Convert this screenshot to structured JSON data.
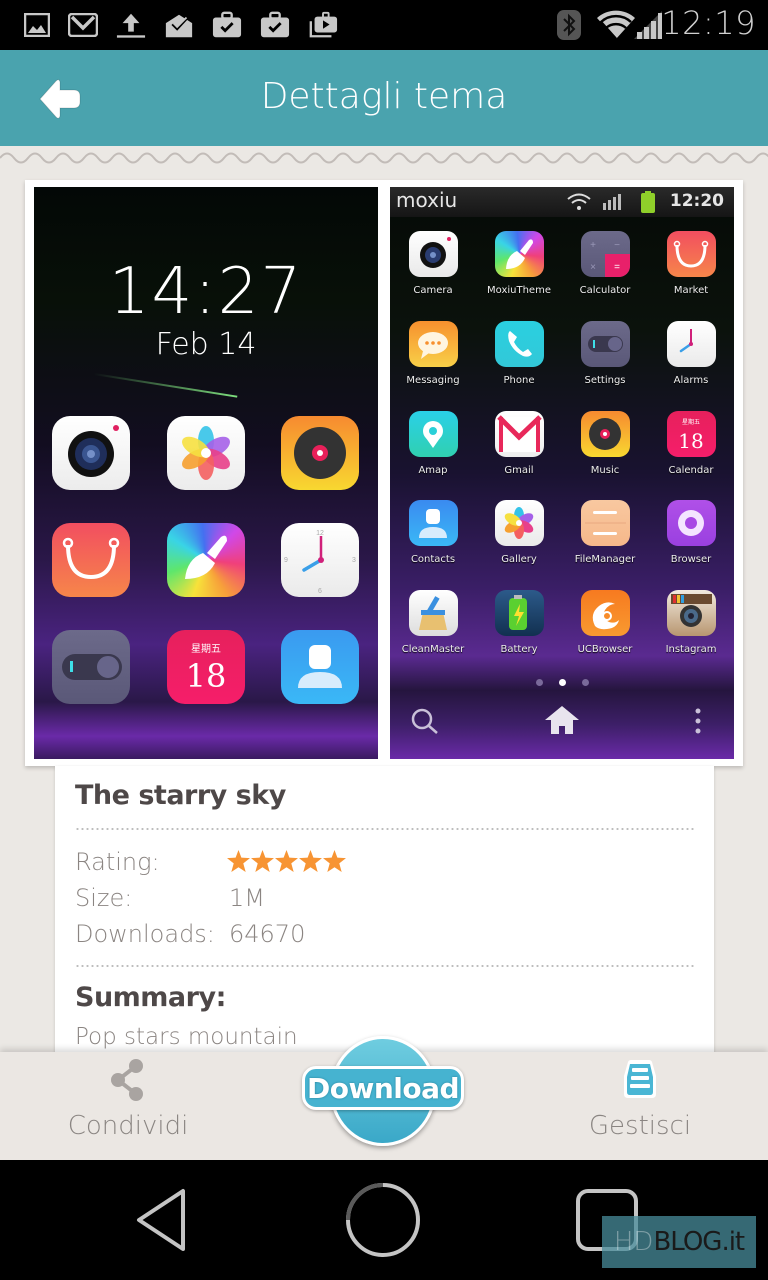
{
  "status_bar": {
    "notification_icons": [
      "gallery-icon",
      "gmail-icon",
      "upload-icon",
      "email-check-icon",
      "briefcase-check-icon",
      "briefcase-check-icon",
      "media-play-icon"
    ],
    "system_icons": [
      "bluetooth-icon",
      "wifi-icon",
      "signal-icon"
    ],
    "time": "12:19"
  },
  "app_bar": {
    "title": "Dettagli tema",
    "back_icon": "back-arrow-icon",
    "color": "#4aa3ae"
  },
  "preview_left": {
    "lock_time": "14:27",
    "lock_date": "Feb 14",
    "calendar_weekday": "星期五",
    "calendar_day": "18",
    "icons": [
      "camera",
      "gallery",
      "music",
      "market",
      "moxiu-theme",
      "clock",
      "settings",
      "calendar",
      "contacts"
    ]
  },
  "preview_right": {
    "brand": "moxiu",
    "time": "12:20",
    "calendar_weekday": "星期五",
    "calendar_day": "18",
    "apps": [
      {
        "label": "Camera"
      },
      {
        "label": "MoxiuTheme"
      },
      {
        "label": "Calculator"
      },
      {
        "label": "Market"
      },
      {
        "label": "Messaging"
      },
      {
        "label": "Phone"
      },
      {
        "label": "Settings"
      },
      {
        "label": "Alarms"
      },
      {
        "label": "Amap"
      },
      {
        "label": "Gmail"
      },
      {
        "label": "Music"
      },
      {
        "label": "Calendar"
      },
      {
        "label": "Contacts"
      },
      {
        "label": "Gallery"
      },
      {
        "label": "FileManager"
      },
      {
        "label": "Browser"
      },
      {
        "label": "CleanMaster"
      },
      {
        "label": "Battery"
      },
      {
        "label": "UCBrowser"
      },
      {
        "label": "Instagram"
      }
    ],
    "page_indicator": {
      "pages": 3,
      "active": 2
    }
  },
  "theme": {
    "name": "The starry sky",
    "rating_label": "Rating:",
    "rating": 5,
    "rating_max": 5,
    "size_label": "Size:",
    "size": "1M",
    "downloads_label": "Downloads:",
    "downloads": "64670",
    "summary_label": "Summary:",
    "summary": "Pop stars mountain",
    "star_color": "#f79433"
  },
  "action_bar": {
    "share_label": "Condividi",
    "download_label": "Download",
    "manage_label": "Gestisci",
    "accent": "#46b3d0"
  },
  "nav_bar": {
    "buttons": [
      "back-icon",
      "home-icon",
      "recents-icon"
    ]
  },
  "watermark": {
    "hd": "HD",
    "blog": "BLOG.it"
  }
}
